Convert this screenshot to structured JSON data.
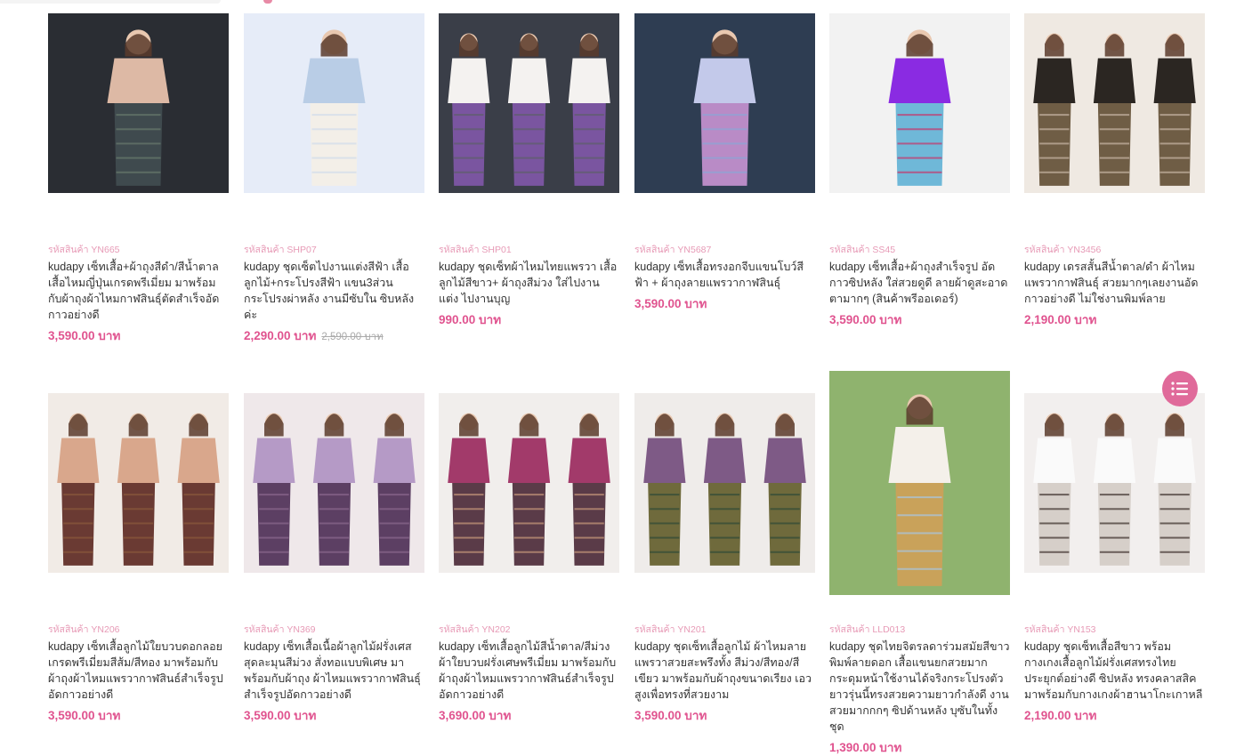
{
  "currency_suffix": "บาท",
  "products": [
    {
      "sku": "รหัสสินค้า YN665",
      "name": "kudapy เซ็ทเสื้อ+ผ้าถุงสีดำ/สีน้ำตาล เสื้อไหมญี่ปุ่นเกรดพรีเมี่ยม มาพร้อมกับผ้าถุงผ้าไหมกาฬสินธุ์ตัดสำเร็จอัดกาวอย่างดี",
      "price": "3,590.00 บาท",
      "old_price": "",
      "colors": [
        "#2a2d33",
        "#ddb9a5",
        "#3f4a4e",
        "#6a7a6e"
      ]
    },
    {
      "sku": "รหัสสินค้า SHP07",
      "name": "kudapy ชุดเซ็ตไปงานแต่งสีฟ้า เสื้อลูกไม้+กระโปรงสีฟ้า แขน3ส่วน กระโปรงผ่าหลัง งานมีซับใน ซิบหลังค่ะ",
      "price": "2,290.00 บาท",
      "old_price": "2,590.00 บาท",
      "colors": [
        "#e6ecf8",
        "#b9cde6",
        "#f3efe8",
        "#cfdceb"
      ]
    },
    {
      "sku": "รหัสสินค้า SHP01",
      "name": "kudapy ชุดเซ็ทผ้าไหมไทยแพรวา เสื้อลูกไม้สีขาว+ ผ้าถุงสีม่วง ใส่ไปงานแต่ง ไปงานบุญ",
      "price": "990.00 บาท",
      "old_price": "",
      "colors": [
        "#3a3e48",
        "#f4f2f0",
        "#7a55a0",
        "#5c5f66"
      ]
    },
    {
      "sku": "รหัสสินค้า YN5687",
      "name": "kudapy เซ็ทเสื้อทรงอกจีบแขนโบว์สีฟ้า + ผ้าถุงลายแพรวากาฬสินธุ์",
      "price": "3,590.00 บาท",
      "old_price": "",
      "colors": [
        "#2e3d52",
        "#c3c9ea",
        "#b98bc6",
        "#8aa6d6"
      ]
    },
    {
      "sku": "รหัสสินค้า SS45",
      "name": "kudapy เซ็ทเสื้อ+ผ้าถุงสำเร็จรูป อัดกาวซิปหลัง ใส่สวยดูดี ลายผ้าดูสะอาดตามากๆ (สินค้าพรีออเดอร์)",
      "price": "3,590.00 บาท",
      "old_price": "",
      "colors": [
        "#f2f2f2",
        "#8a2be2",
        "#6fb8d8",
        "#c8336a"
      ]
    },
    {
      "sku": "รหัสสินค้า YN3456",
      "name": "kudapy เดรสสั้นสีน้ำตาล/ดำ ผ้าไหมแพรวากาฬสินธุ์ สวยมากๆเลยงานอัดกาวอย่างดี ไม่ใช่งานพิมพ์ลาย",
      "price": "2,190.00 บาท",
      "old_price": "",
      "colors": [
        "#efe9e2",
        "#2b2622",
        "#6f5d45",
        "#c9b8a6"
      ]
    },
    {
      "sku": "รหัสสินค้า YN206",
      "name": "kudapy เซ็ทเสื้อลูกไม้ใยบวบดอกลอยเกรดพรีเมี่ยมสีส้ม/สีทอง มาพร้อมกับผ้าถุงผ้าไหมแพรวากาฬสินธ์สำเร็จรูปอัดกาวอย่างดี",
      "price": "3,590.00 บาท",
      "old_price": "",
      "colors": [
        "#f1ebe6",
        "#d9a78c",
        "#6a3a33",
        "#8b5a3c"
      ]
    },
    {
      "sku": "รหัสสินค้า YN369",
      "name": "kudapy เซ็ทเสื้อเนื้อผ้าลูกไม้ฝรั่งเศสสุดละมุนสีม่วง สั่งทอแบบพิเศษ มาพร้อมกับผ้าถุง ผ้าไหมแพรวากาฬสินธุ์สำเร็จรูปอัดกาวอย่างดี",
      "price": "3,590.00 บาท",
      "old_price": "",
      "colors": [
        "#efe8ea",
        "#b59ac6",
        "#5c3f63",
        "#8c6a8e"
      ]
    },
    {
      "sku": "รหัสสินค้า YN202",
      "name": "kudapy เซ็ทเสื้อลูกไม้สีน้ำตาล/สีม่วง ผ้าใยบวบฝรั่งเศษพรีเมี่ยม มาพร้อมกับผ้าถุงผ้าไหมแพรวากาฬสินธ์สำเร็จรูปอัดกาวอย่างดี",
      "price": "3,690.00 บาท",
      "old_price": "",
      "colors": [
        "#f1eeec",
        "#a23a6a",
        "#5a3b48",
        "#c79a7c"
      ]
    },
    {
      "sku": "รหัสสินค้า YN201",
      "name": "kudapy ชุดเซ็ทเสื้อลูกไม้ ผ้าไหมลายแพรวาสวยสะพรึงทั้ง สีม่วง/สีทอง/สีเขียว มาพร้อมกับผ้าถุงขนาดเรียง เอวสูงเพื่อทรงที่สวยงาม",
      "price": "3,590.00 บาท",
      "old_price": "",
      "colors": [
        "#efecea",
        "#7e5a86",
        "#6f6a3c",
        "#2f4a36"
      ]
    },
    {
      "sku": "รหัสสินค้า LLD013",
      "name": "kudapy ชุดไทยจิตรลดาร่วมสมัยสีขาว พิมพ์ลายดอก เสื้อแขนยกสวยมากกระดุมหน้าใช้งานได้จริงกระโปรงตัวยาวรุ่นนี้ทรงสวยความยาวกำลังดี งานสวยมากกกๆ ซิปด้านหลัง บุซับในทั้งชุด",
      "price": "1,390.00 บาท",
      "old_price": "",
      "colors": [
        "#8fb36e",
        "#f4f0ea",
        "#c9a25a",
        "#a7c7e6"
      ]
    },
    {
      "sku": "รหัสสินค้า YN153",
      "name": "kudapy ชุดเซ็ทเสื้อสีขาว พร้อมกางเกงเสื้อลูกไม้ฝรั่งเศสทรงไทยประยุกต์อย่างดี ซิปหลัง ทรงคลาสสิคมาพร้อมกับกางเกงผ้าฮานาโกะเกาหลี",
      "price": "2,190.00 บาท",
      "old_price": "",
      "colors": [
        "#f2efee",
        "#fafafa",
        "#d6cfc9",
        "#3a2e2a"
      ]
    }
  ]
}
